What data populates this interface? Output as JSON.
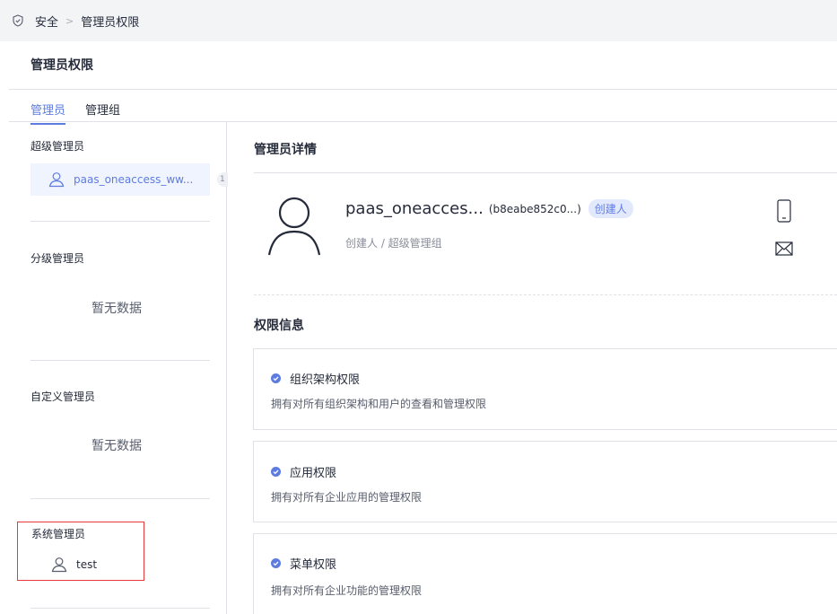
{
  "breadcrumb": {
    "root": "安全",
    "current": "管理员权限",
    "separator": ">"
  },
  "page": {
    "title": "管理员权限"
  },
  "tabs": [
    {
      "label": "管理员",
      "active": true
    },
    {
      "label": "管理组",
      "active": false
    }
  ],
  "sidebar": {
    "super_admin": {
      "label": "超级管理员",
      "items": [
        {
          "name": "paas_oneaccess_ww..."
        }
      ],
      "badge": "1"
    },
    "tier_admin": {
      "label": "分级管理员",
      "empty": "暂无数据"
    },
    "custom_admin": {
      "label": "自定义管理员",
      "empty": "暂无数据"
    },
    "system_admin": {
      "label": "系统管理员",
      "items": [
        {
          "name": "test"
        }
      ]
    }
  },
  "detail": {
    "title": "管理员详情",
    "name": "paas_oneacces...",
    "id": "(b8eabe852c0...)",
    "badge": "创建人",
    "role": "创建人 / 超级管理组"
  },
  "permissions": {
    "title": "权限信息",
    "items": [
      {
        "name": "组织架构权限",
        "desc": "拥有对所有组织架构和用户的查看和管理权限"
      },
      {
        "name": "应用权限",
        "desc": "拥有对所有企业应用的管理权限"
      },
      {
        "name": "菜单权限",
        "desc": "拥有对所有企业功能的管理权限"
      }
    ]
  },
  "colors": {
    "accent": "#5e7ce0",
    "highlight_border": "#e5393b",
    "breadcrumb_bg": "#f3f4f6"
  }
}
